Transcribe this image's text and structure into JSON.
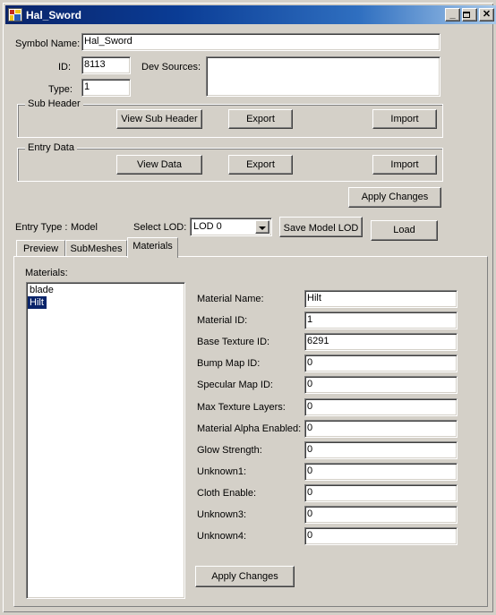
{
  "window": {
    "title": "Hal_Sword",
    "icon": "form-designer-icon",
    "controls": {
      "minimize": "_",
      "maximize": "□",
      "close": "✕"
    }
  },
  "header": {
    "symbol_name_label": "Symbol Name:",
    "symbol_name_value": "Hal_Sword",
    "id_label": "ID:",
    "id_value": "8113",
    "type_label": "Type:",
    "type_value": "1",
    "dev_sources_label": "Dev Sources:",
    "dev_sources_value": ""
  },
  "sub_header_group": {
    "title": "Sub Header",
    "view_button": "View Sub Header",
    "export_button": "Export",
    "import_button": "Import"
  },
  "entry_data_group": {
    "title": "Entry Data",
    "view_button": "View Data",
    "export_button": "Export",
    "import_button": "Import"
  },
  "apply_changes_top": "Apply Changes",
  "entry_row": {
    "entry_type_label": "Entry Type :",
    "entry_type_value": "Model",
    "select_lod_label": "Select LOD:",
    "lod_selected": "LOD 0",
    "save_model_lod_button": "Save Model LOD",
    "load_button": "Load"
  },
  "tabs": [
    {
      "label": "Preview",
      "active": false
    },
    {
      "label": "SubMeshes",
      "active": false
    },
    {
      "label": "Materials",
      "active": true
    }
  ],
  "materials_tab": {
    "list_label": "Materials:",
    "list_items": [
      {
        "label": "blade",
        "selected": false
      },
      {
        "label": "Hilt",
        "selected": true
      }
    ],
    "fields": [
      {
        "label": "Material Name:",
        "value": "Hilt"
      },
      {
        "label": "Material ID:",
        "value": "1"
      },
      {
        "label": "Base Texture ID:",
        "value": "6291"
      },
      {
        "label": "Bump Map ID:",
        "value": "0"
      },
      {
        "label": "Specular Map ID:",
        "value": "0"
      },
      {
        "label": "Max Texture Layers:",
        "value": "0"
      },
      {
        "label": "Material Alpha Enabled:",
        "value": "0"
      },
      {
        "label": "Glow Strength:",
        "value": "0"
      },
      {
        "label": "Unknown1:",
        "value": "0"
      },
      {
        "label": "Cloth Enable:",
        "value": "0"
      },
      {
        "label": "Unknown3:",
        "value": "0"
      },
      {
        "label": "Unknown4:",
        "value": "0"
      }
    ],
    "apply_changes_button": "Apply Changes"
  },
  "colors": {
    "face": "#d4d0c8",
    "title_gradient_start": "#0a246a",
    "title_gradient_end": "#a6c8ea",
    "selection": "#0a246a",
    "field_background": "#ffffff"
  }
}
